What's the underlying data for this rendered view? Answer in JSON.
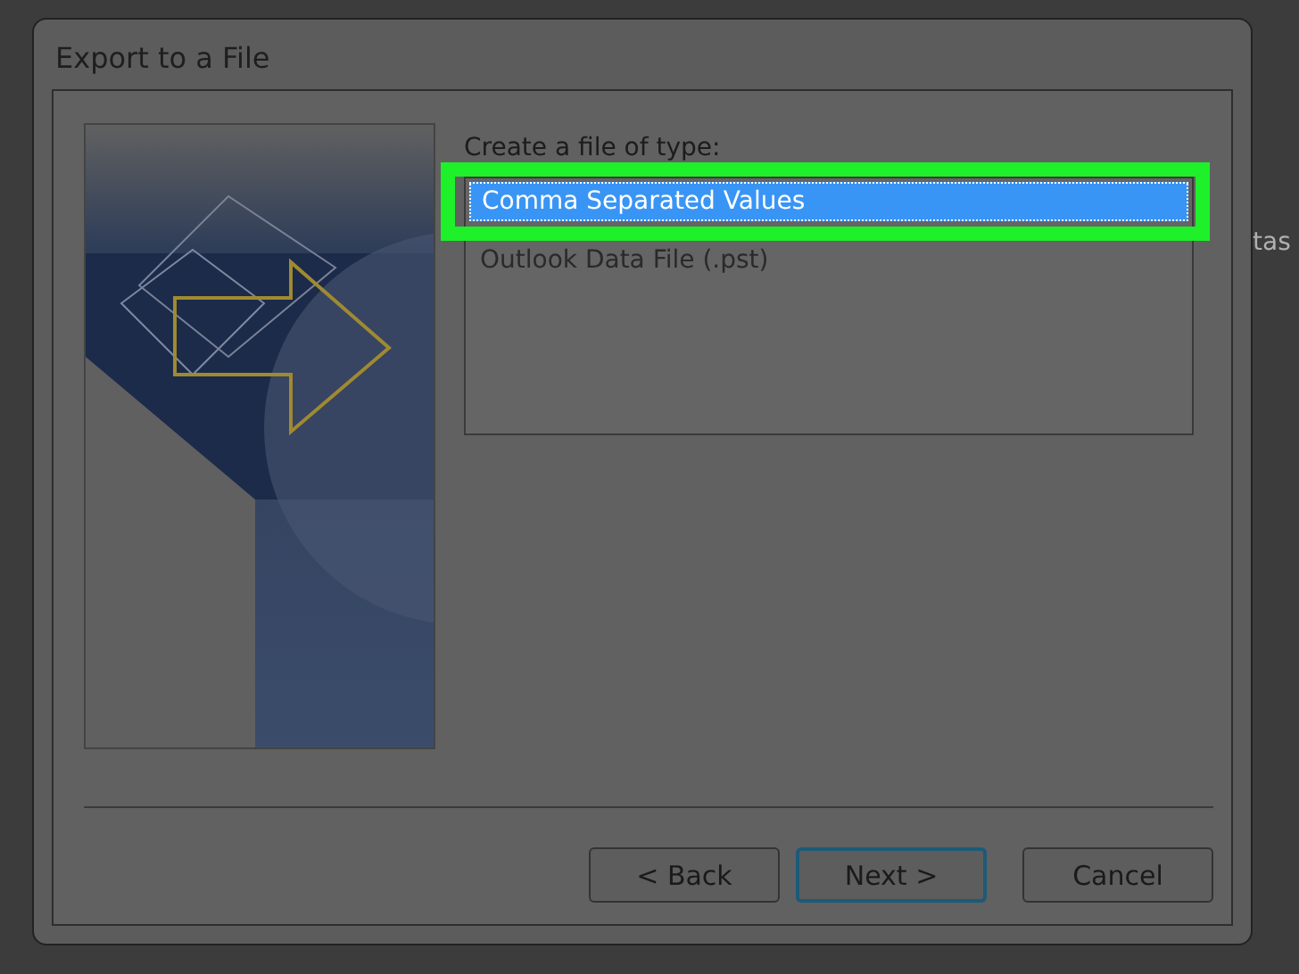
{
  "window": {
    "title": "Export to a File"
  },
  "backdrop_text": "tas",
  "file_type": {
    "label": "Create a file of type:",
    "items": [
      {
        "label": "Comma Separated Values",
        "selected": true,
        "highlighted": true
      },
      {
        "label": "Outlook Data File (.pst)",
        "selected": false,
        "highlighted": false
      }
    ]
  },
  "buttons": [
    {
      "label": "< Back",
      "default": false
    },
    {
      "label": "Next >",
      "default": true
    },
    {
      "label": "Cancel",
      "default": false
    }
  ]
}
